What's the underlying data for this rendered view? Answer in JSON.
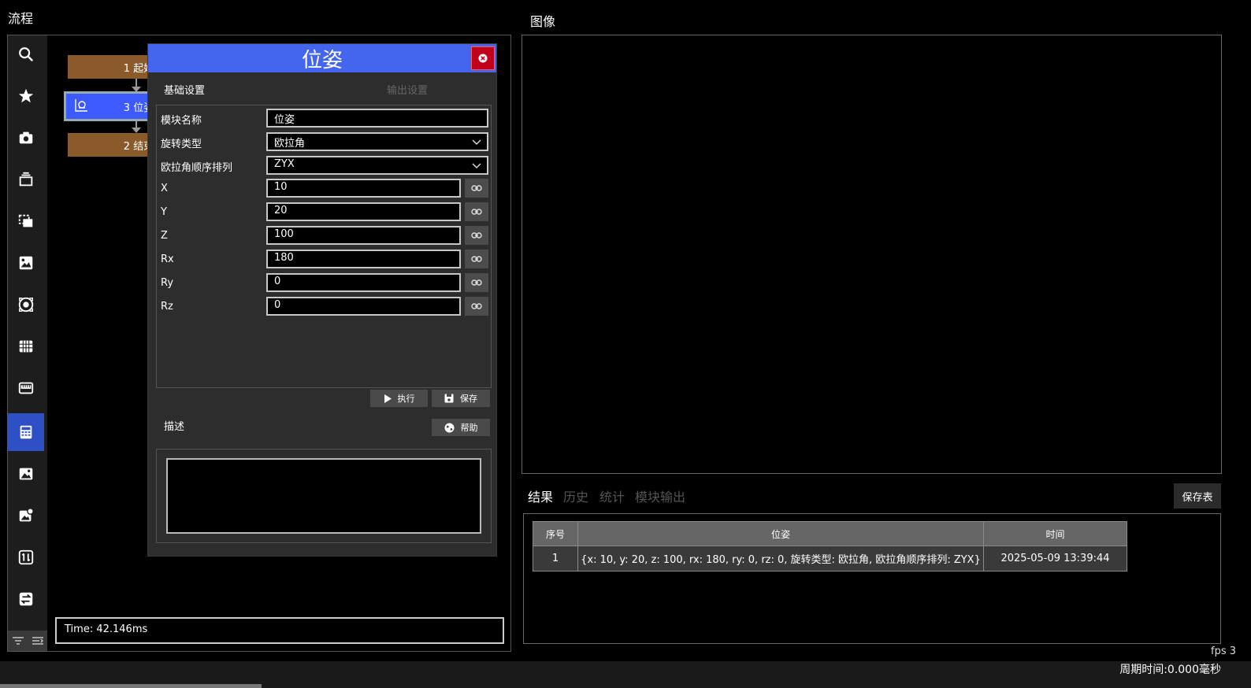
{
  "flow": {
    "title": "流程",
    "time_label": "Time: 42.146ms",
    "nodes": [
      {
        "label": "1 起始"
      },
      {
        "label": "3 位姿"
      },
      {
        "label": "2 结束"
      }
    ],
    "toolbar_icons": [
      "search-icon",
      "star-icon",
      "camera-icon",
      "layers-icon",
      "copy-icon",
      "image-edit-icon",
      "target-icon",
      "grid-icon",
      "ruler-icon",
      "calculator-icon",
      "picture-icon",
      "settings-image-icon",
      "transform-icon",
      "swap-icon"
    ]
  },
  "dialog": {
    "title": "位姿",
    "tab_basic": "基础设置",
    "tab_output": "输出设置",
    "fields": {
      "module_name": {
        "label": "模块名称",
        "value": "位姿"
      },
      "rotation_type": {
        "label": "旋转类型",
        "value": "欧拉角"
      },
      "euler_order": {
        "label": "欧拉角顺序排列",
        "value": "ZYX"
      },
      "x": {
        "label": "X",
        "value": "10"
      },
      "y": {
        "label": "Y",
        "value": "20"
      },
      "z": {
        "label": "Z",
        "value": "100"
      },
      "rx": {
        "label": "Rx",
        "value": "180"
      },
      "ry": {
        "label": "Ry",
        "value": "0"
      },
      "rz": {
        "label": "Rz",
        "value": "0"
      }
    },
    "execute_label": "执行",
    "save_label": "保存",
    "description_label": "描述",
    "help_label": "帮助"
  },
  "image": {
    "title": "图像"
  },
  "results": {
    "tabs": [
      "结果",
      "历史",
      "统计",
      "模块输出"
    ],
    "save_table_label": "保存表",
    "columns": [
      "序号",
      "位姿",
      "时间"
    ],
    "rows": [
      [
        "1",
        "{x: 10, y: 20, z: 100, rx: 180, ry: 0, rz: 0, 旋转类型: 欧拉角, 欧拉角顺序排列: ZYX}",
        "2025-05-09 13:39:44"
      ]
    ]
  },
  "status": {
    "fps": "fps 3",
    "cycle_time": "周期时间:0.000毫秒"
  },
  "colors": {
    "accent_blue": "#4466ee",
    "node_brown": "#8b5a2b",
    "close_red": "#c0001a"
  }
}
